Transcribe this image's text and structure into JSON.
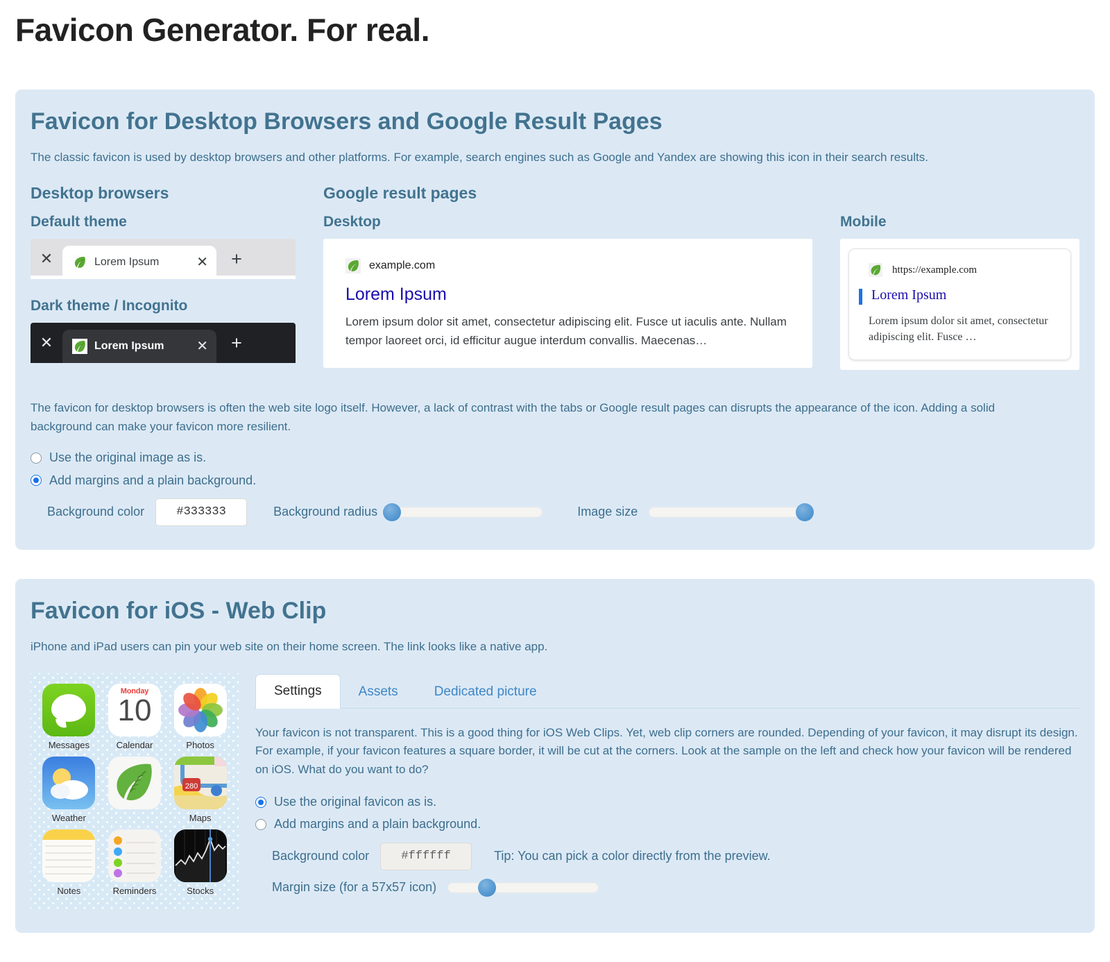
{
  "page": {
    "title": "Favicon Generator. For real."
  },
  "desktop_section": {
    "title": "Favicon for Desktop Browsers and Google Result Pages",
    "description": "The classic favicon is used by desktop browsers and other platforms. For example, search engines such as Google and Yandex are showing this icon in their search results.",
    "browsers_heading": "Desktop browsers",
    "google_heading": "Google result pages",
    "default_theme_label": "Default theme",
    "dark_theme_label": "Dark theme / Incognito",
    "tab_title": "Lorem Ipsum",
    "tab_close_icon": "close-icon",
    "tab_new_icon": "plus-icon",
    "google_desktop_label": "Desktop",
    "google_mobile_label": "Mobile",
    "google_desktop": {
      "domain": "example.com",
      "title": "Lorem Ipsum",
      "snippet": "Lorem ipsum dolor sit amet, consectetur adipiscing elit. Fusce ut iaculis ante. Nullam tempor laoreet orci, id efficitur augue interdum convallis. Maecenas…"
    },
    "google_mobile": {
      "url": "https://example.com",
      "title": "Lorem Ipsum",
      "snippet": "Lorem ipsum dolor sit amet, consectetur adipiscing elit. Fusce …"
    },
    "note": "The favicon for desktop browsers is often the web site logo itself. However, a lack of contrast with the tabs or Google result pages can disrupts the appearance of the icon. Adding a solid background can make your favicon more resilient.",
    "options": [
      {
        "label": "Use the original image as is.",
        "checked": false
      },
      {
        "label": "Add margins and a plain background.",
        "checked": true
      }
    ],
    "background_color_label": "Background color",
    "background_color_value": "#333333",
    "background_radius_label": "Background radius",
    "background_radius_percent": 2,
    "image_size_label": "Image size",
    "image_size_percent": 97
  },
  "ios_section": {
    "title": "Favicon for iOS - Web Clip",
    "description": "iPhone and iPad users can pin your web site on their home screen. The link looks like a native app.",
    "home_screen_apps": [
      {
        "name": "Messages",
        "icon": "messages-icon"
      },
      {
        "name": "Calendar",
        "icon": "calendar-icon",
        "day": "Monday",
        "number": "10"
      },
      {
        "name": "Photos",
        "icon": "photos-icon"
      },
      {
        "name": "Weather",
        "icon": "weather-icon"
      },
      {
        "name": "",
        "icon": "leaf-favicon-preview-icon"
      },
      {
        "name": "Maps",
        "icon": "maps-icon",
        "route": "280"
      },
      {
        "name": "Notes",
        "icon": "notes-icon"
      },
      {
        "name": "Reminders",
        "icon": "reminders-icon"
      },
      {
        "name": "Stocks",
        "icon": "stocks-icon"
      }
    ],
    "tabs": [
      {
        "label": "Settings",
        "active": true
      },
      {
        "label": "Assets",
        "active": false
      },
      {
        "label": "Dedicated picture",
        "active": false
      }
    ],
    "settings_text": "Your favicon is not transparent. This is a good thing for iOS Web Clips. Yet, web clip corners are rounded. Depending of your favicon, it may disrupt its design. For example, if your favicon features a square border, it will be cut at the corners. Look at the sample on the left and check how your favicon will be rendered on iOS. What do you want to do?",
    "options": [
      {
        "label": "Use the original favicon as is.",
        "checked": true
      },
      {
        "label": "Add margins and a plain background.",
        "checked": false
      }
    ],
    "background_color_label": "Background color",
    "background_color_value": "#ffffff",
    "tip": "Tip: You can pick a color directly from the preview.",
    "margin_size_label": "Margin size (for a 57x57 icon)",
    "margin_size_percent": 26
  },
  "colors": {
    "panel_background": "#dce9f5",
    "heading": "#42738f",
    "body_text": "#3d6e8d",
    "link": "#3f86c4",
    "google_link": "#1a0dab",
    "slider_thumb": "#5b9bd5",
    "radio_checked": "#1a73e8",
    "favicon_background": "#333333"
  }
}
